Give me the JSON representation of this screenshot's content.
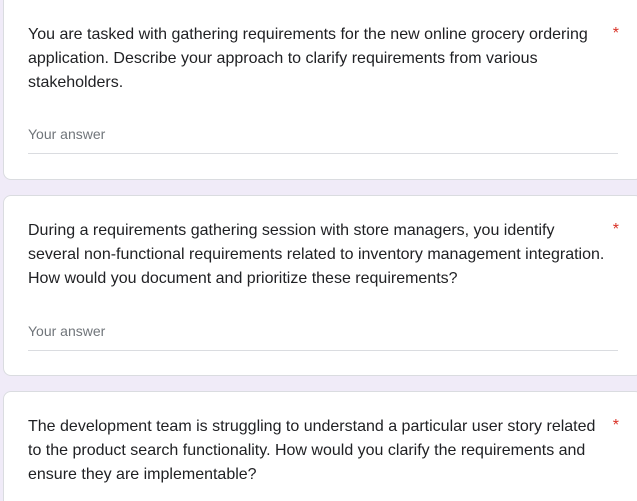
{
  "questions": [
    {
      "text": "You are tasked with gathering requirements for the new online grocery ordering application. Describe your approach to clarify requirements from various stakeholders.",
      "required_marker": "*",
      "answer_placeholder": "Your answer"
    },
    {
      "text": "During a requirements gathering session with store managers, you identify several non-functional requirements related to inventory management integration. How would you document and prioritize these requirements?",
      "required_marker": "*",
      "answer_placeholder": "Your answer"
    },
    {
      "text": "The development team is struggling to understand a particular user story related to the product search functionality. How would you clarify the requirements and ensure they are implementable?",
      "required_marker": "*",
      "answer_placeholder": "Your answer"
    }
  ],
  "colors": {
    "background": "#f0ebf8",
    "card": "#ffffff",
    "required": "#d93025",
    "text": "#202124",
    "placeholder": "#70757a"
  }
}
